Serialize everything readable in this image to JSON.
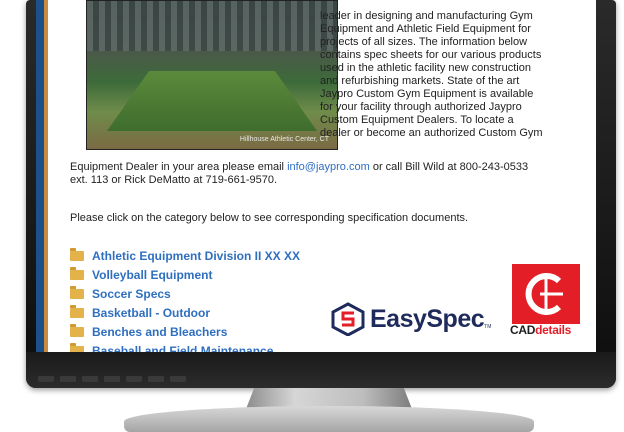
{
  "content": {
    "photo_caption": "Hillhouse Athletic Center, CT",
    "intro_lines": [
      "leader in designing and manufacturing Gym",
      "Equipment and Athletic Field Equipment for",
      "projects of all sizes. The information below",
      "contains spec sheets for our various products",
      "used in the athletic facility new construction",
      "and refurbishing markets. State of the art",
      "Jaypro Custom Gym Equipment is available",
      "for your facility through authorized Jaypro",
      "Custom Equipment Dealers. To locate a",
      "dealer or become an authorized Custom Gym"
    ],
    "cont_line1_pre": "Equipment Dealer in your area please email ",
    "email": "info@jaypro.com",
    "cont_line1_post": " or call Bill Wild at 800-243-0533",
    "cont_line2": "ext. 113 or Rick DeMatto at 719-661-9570.",
    "prompt": "Please click on the category below to see corresponding specification documents.",
    "categories": [
      "Athletic Equipment Division II XX XX",
      "Volleyball Equipment",
      "Soccer Specs",
      "Basketball - Outdoor",
      "Benches and Bleachers",
      "Baseball and Field Maintenance"
    ]
  },
  "logos": {
    "easyspec_name": "EasySpec",
    "easyspec_tm": "TM",
    "cad_name_a": "CAD",
    "cad_name_b": "details"
  },
  "bezel_buttons": [
    "",
    "",
    "",
    "",
    "",
    "",
    ""
  ],
  "colors": {
    "link": "#2f6fc0",
    "cad_red": "#e31e27",
    "easyspec_navy": "#1e2b5c",
    "folder": "#e3b24a",
    "sidebar_blue": "#1d4f8a",
    "sidebar_orange": "#c98b3d"
  }
}
